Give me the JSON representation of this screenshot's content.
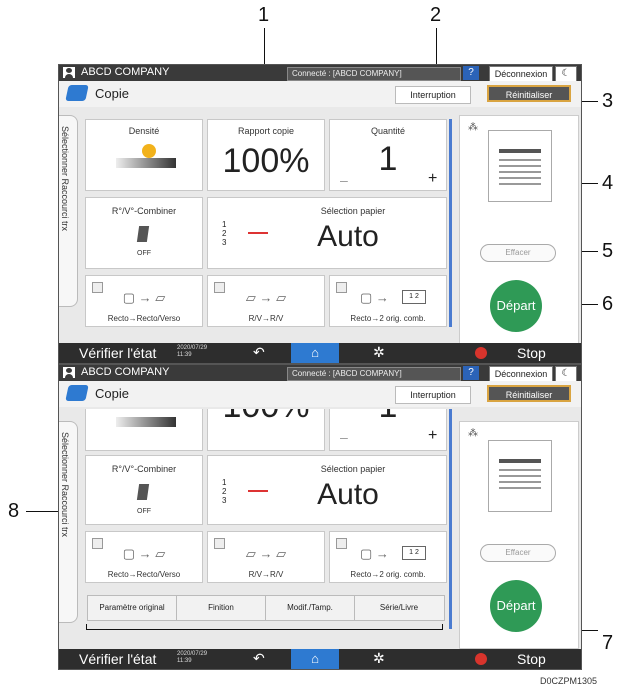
{
  "callouts": [
    "1",
    "2",
    "3",
    "4",
    "5",
    "6",
    "7",
    "8"
  ],
  "header": {
    "company": "ABCD COMPANY",
    "connected": "Connecté : [ABCD COMPANY]",
    "help": "?",
    "logout": "Déconnexion",
    "sleep": "☾"
  },
  "app": {
    "title": "Copie",
    "interruption": "Interruption",
    "reset": "Réinitialiser"
  },
  "sidetab": "Sélectionner Raccourci trx",
  "tiles": {
    "density_label": "Densité",
    "ratio_label": "Rapport copie",
    "ratio_value": "100%",
    "quantity_label": "Quantité",
    "quantity_value": "1",
    "minus": "–",
    "plus": "+",
    "combine_label": "R°/V°-Combiner",
    "combine_state": "OFF",
    "paper_label": "Sélection papier",
    "paper_value": "Auto",
    "paper_trays": "1\n2\n3",
    "duplex1": "Recto→Recto/Verso",
    "duplex2": "R/V→R/V",
    "duplex3": "Recto→2 orig. comb.",
    "duplex3_icon": "1 2",
    "ratio_partial": "100%"
  },
  "right": {
    "erase": "Effacer",
    "start": "Départ"
  },
  "status": {
    "check": "Vérifier l'état",
    "date": "2020/07/29\n11:39",
    "stop": "Stop"
  },
  "tabs": [
    "Paramètre original",
    "Finition",
    "Modif./Tamp.",
    "Série/Livre"
  ],
  "footer_code": "D0CZPM1305"
}
